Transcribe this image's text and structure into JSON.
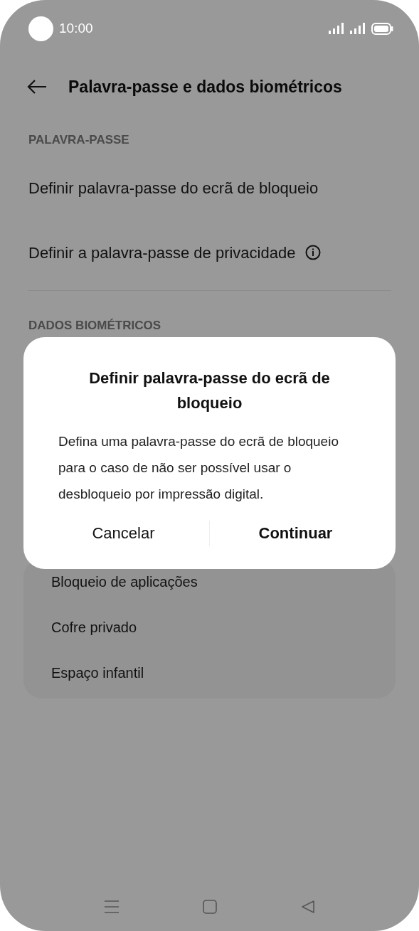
{
  "status_bar": {
    "time": "10:00"
  },
  "header": {
    "title": "Palavra-passe e dados biométricos"
  },
  "sections": [
    {
      "heading": "PALAVRA-PASSE",
      "items": [
        {
          "label": "Definir palavra-passe do ecrã de bloqueio",
          "info": false
        },
        {
          "label": "Definir a palavra-passe de privacidade",
          "info": true
        }
      ]
    },
    {
      "heading": "DADOS BIOMÉTRICOS"
    }
  ],
  "card_items": [
    "Bloqueio de aplicações",
    "Cofre privado",
    "Espaço infantil"
  ],
  "dialog": {
    "title": "Definir palavra-passe do ecrã de bloqueio",
    "message": "Defina uma palavra-passe do ecrã de bloqueio para o caso de não ser possível usar o desbloqueio por impressão digital.",
    "buttons": [
      {
        "label": "Cancelar",
        "primary": false
      },
      {
        "label": "Continuar",
        "primary": true
      }
    ]
  }
}
